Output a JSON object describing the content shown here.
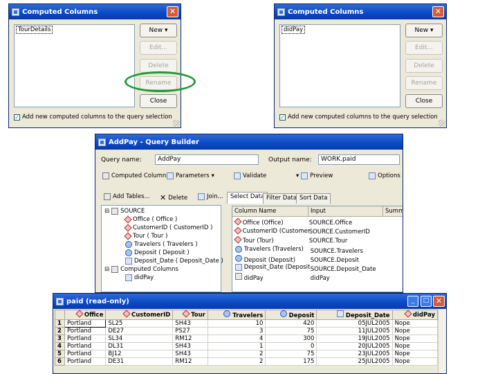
{
  "dialog_left": {
    "title": "Computed Columns",
    "list_items": [
      "TourDetails"
    ],
    "buttons": {
      "new": "New",
      "edit": "Edit...",
      "delete": "Delete",
      "rename": "Rename",
      "close": "Close"
    },
    "checkbox_label": "Add new computed columns to the query selection",
    "checkbox_checked": true
  },
  "dialog_right": {
    "title": "Computed Columns",
    "list_items": [
      "didPay"
    ],
    "buttons": {
      "new": "New",
      "edit": "Edit...",
      "delete": "Delete",
      "rename": "Rename",
      "close": "Close"
    },
    "checkbox_label": "Add new computed columns to the query selection",
    "checkbox_checked": true
  },
  "query_builder": {
    "title": "AddPay - Query Builder",
    "query_name_label": "Query name:",
    "query_name_value": "AddPay",
    "output_name_label": "Output name:",
    "output_name_value": "WORK.paid",
    "toolbar": {
      "computed_columns": "Computed Columns",
      "parameters": "Parameters",
      "validate": "Validate",
      "preview": "Preview",
      "options": "Options"
    },
    "left_toolbar": {
      "add_tables": "Add Tables...",
      "delete": "Delete",
      "join": "Join..."
    },
    "tree": {
      "source": "SOURCE",
      "source_items": [
        "Office ( Office )",
        "CustomerID ( CustomerID )",
        "Tour ( Tour )",
        "Travelers ( Travelers )",
        "Deposit ( Deposit )",
        "Deposit_Date ( Deposit_Date )"
      ],
      "computed": "Computed Columns",
      "computed_items": [
        "didPay"
      ]
    },
    "tabs": [
      "Select Data",
      "Filter Data",
      "Sort Data"
    ],
    "grid_headers": [
      "Column Name",
      "Input",
      "Summary"
    ],
    "grid_rows": [
      {
        "name": "Office (Office)",
        "input": "SOURCE.Office",
        "icon": "red"
      },
      {
        "name": "CustomerID (CustomerID)",
        "input": "SOURCE.CustomerID",
        "icon": "red"
      },
      {
        "name": "Tour (Tour)",
        "input": "SOURCE.Tour",
        "icon": "red"
      },
      {
        "name": "Travelers (Travelers)",
        "input": "SOURCE.Travelers",
        "icon": "blue"
      },
      {
        "name": "Deposit (Deposit)",
        "input": "SOURCE.Deposit",
        "icon": "blue"
      },
      {
        "name": "Deposit_Date (Deposit...",
        "input": "SOURCE.Deposit_Date",
        "icon": "cal"
      },
      {
        "name": "didPay",
        "input": "didPay",
        "icon": "tbl"
      }
    ]
  },
  "paid_window": {
    "title": "paid (read-only)",
    "headers": [
      "Office",
      "CustomerID",
      "Tour",
      "Travelers",
      "Deposit",
      "Deposit_Date",
      "didPay"
    ],
    "rows": [
      [
        "1",
        "Portland",
        "SL25",
        "SH43",
        "10",
        "420",
        "05JUL2005",
        "Nope"
      ],
      [
        "2",
        "Portland",
        "DE27",
        "PS27",
        "3",
        "75",
        "11JUL2005",
        "Nope"
      ],
      [
        "3",
        "Portland",
        "SL34",
        "RM12",
        "4",
        "300",
        "19JUL2005",
        "Nope"
      ],
      [
        "4",
        "Portland",
        "DL31",
        "SH43",
        "1",
        "0",
        "20JUL2005",
        "Nope"
      ],
      [
        "5",
        "Portland",
        "BJ12",
        "SH43",
        "2",
        "75",
        "23JUL2005",
        "Nope"
      ],
      [
        "6",
        "Portland",
        "DE31",
        "RM12",
        "2",
        "175",
        "25JUL2005",
        "Nope"
      ]
    ]
  }
}
